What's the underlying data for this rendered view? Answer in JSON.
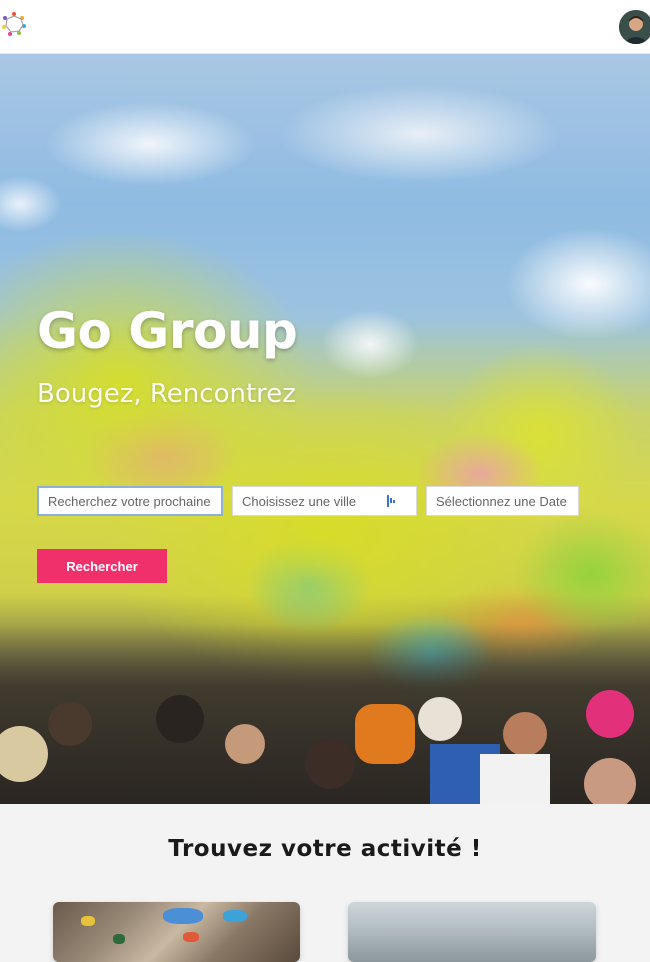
{
  "header": {
    "logo_icon": "colorful-people-circle-logo",
    "avatar_icon": "user-avatar"
  },
  "hero": {
    "title": "Go Group",
    "subtitle": "Bougez, Rencontrez",
    "search": {
      "activity_placeholder": "Recherchez votre prochaine a",
      "city_placeholder": "Choisissez une ville",
      "date_placeholder": "Sélectionnez une Date",
      "button_label": "Rechercher"
    },
    "colors": {
      "button": "#f0306a"
    }
  },
  "section": {
    "title": "Trouvez votre activité !",
    "cards": [
      {
        "icon": "climbing-wall-image"
      },
      {
        "icon": "lake-landscape-image"
      }
    ]
  }
}
